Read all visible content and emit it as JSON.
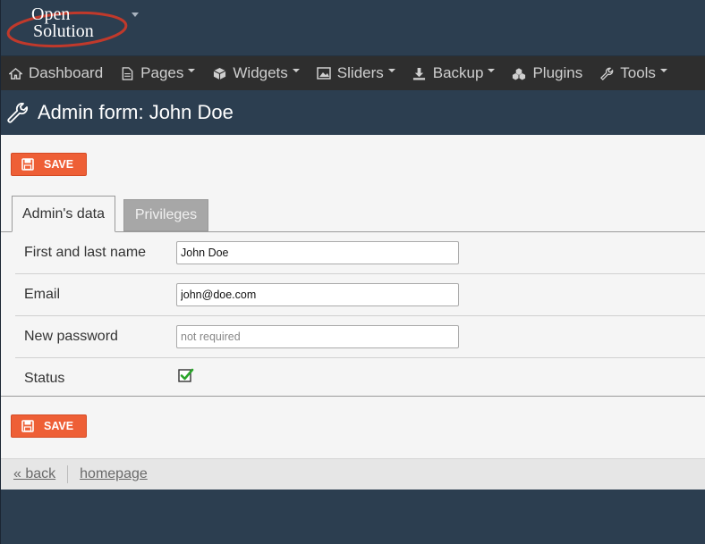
{
  "logo": {
    "line1": "Open",
    "line2": "Solution"
  },
  "nav": {
    "items": [
      {
        "label": "Dashboard",
        "icon": "home-icon",
        "has_caret": false
      },
      {
        "label": "Pages",
        "icon": "page-icon",
        "has_caret": true
      },
      {
        "label": "Widgets",
        "icon": "cube-icon",
        "has_caret": true
      },
      {
        "label": "Sliders",
        "icon": "image-icon",
        "has_caret": true
      },
      {
        "label": "Backup",
        "icon": "download-icon",
        "has_caret": true
      },
      {
        "label": "Plugins",
        "icon": "cubes-icon",
        "has_caret": false
      },
      {
        "label": "Tools",
        "icon": "wrench-icon",
        "has_caret": true
      }
    ]
  },
  "title": "Admin form: John Doe",
  "actions": {
    "save_label": "SAVE"
  },
  "tabs": [
    {
      "label": "Admin's data",
      "active": true
    },
    {
      "label": "Privileges",
      "active": false
    }
  ],
  "form": {
    "name": {
      "label": "First and last name",
      "value": "John Doe"
    },
    "email": {
      "label": "Email",
      "value": "john@doe.com"
    },
    "password": {
      "label": "New password",
      "value": "",
      "placeholder": "not required"
    },
    "status": {
      "label": "Status",
      "checked": true
    }
  },
  "footer": {
    "back_label": "« back",
    "homepage_label": "homepage"
  },
  "colors": {
    "header_bg": "#2c3e50",
    "nav_bg": "#2e2e2e",
    "save_button": "#ee5f36",
    "checkmark": "#2aa52a"
  }
}
